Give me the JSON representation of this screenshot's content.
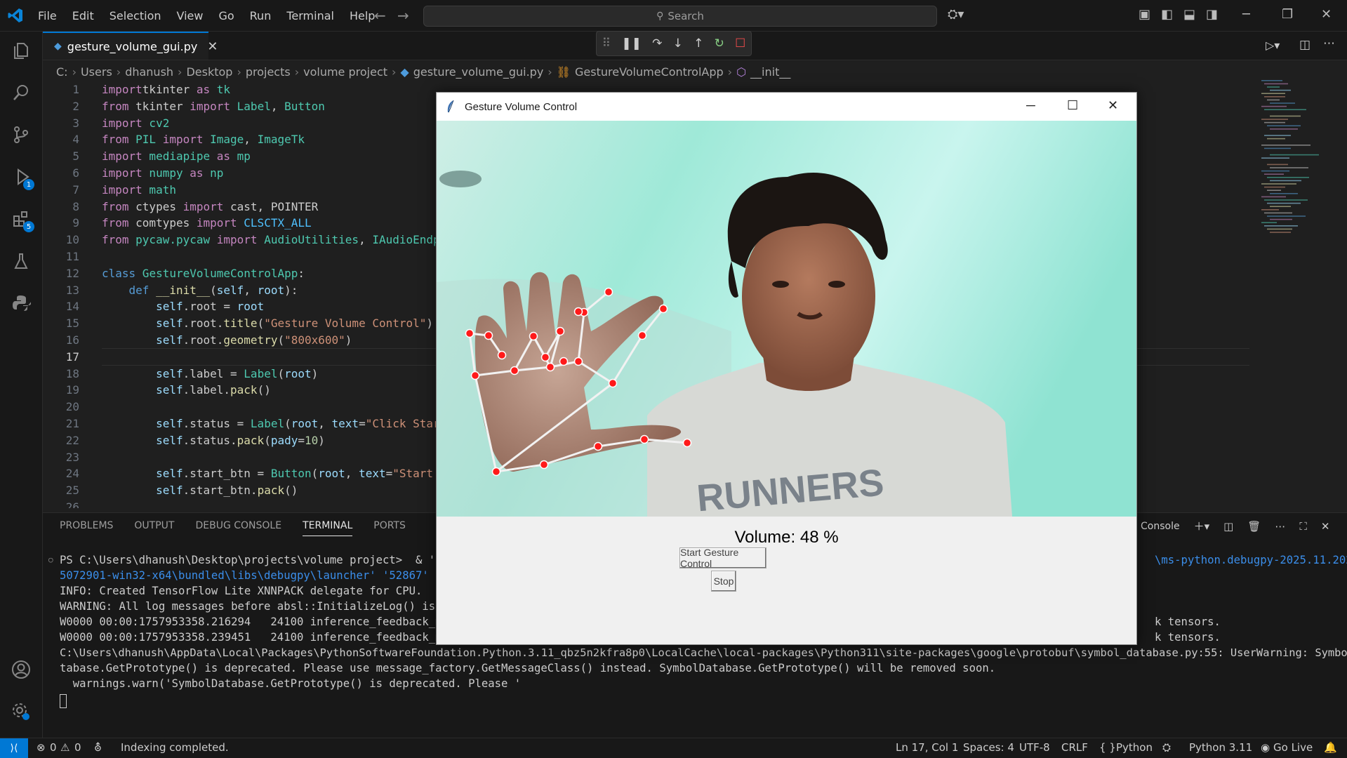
{
  "menu": [
    "File",
    "Edit",
    "Selection",
    "View",
    "Go",
    "Run",
    "Terminal",
    "Help"
  ],
  "search": {
    "label": "Search"
  },
  "activity_badges": {
    "run_debug": "1",
    "extensions": "5"
  },
  "editor": {
    "tab": "gesture_volume_gui.py",
    "breadcrumbs": [
      "C:",
      "Users",
      "dhanush",
      "Desktop",
      "projects",
      "volume project",
      "gesture_volume_gui.py",
      "GestureVolumeControlApp",
      "__init__"
    ],
    "line_numbers": [
      "1",
      "2",
      "3",
      "4",
      "5",
      "6",
      "7",
      "8",
      "9",
      "10",
      "11",
      "12",
      "13",
      "14",
      "15",
      "16",
      "17",
      "18",
      "19",
      "20",
      "21",
      "22",
      "23",
      "24",
      "25",
      "26"
    ],
    "code": [
      [
        [
          "kw",
          "import"
        ],
        [
          "",
          "tkinter "
        ],
        [
          "kw",
          "as"
        ],
        [
          "cls",
          " tk"
        ]
      ],
      [
        [
          "kw",
          "from"
        ],
        [
          "",
          " tkinter "
        ],
        [
          "kw",
          "import"
        ],
        [
          "cls",
          " Label"
        ],
        [
          "",
          ", "
        ],
        [
          "cls",
          "Button"
        ]
      ],
      [
        [
          "kw",
          "import"
        ],
        [
          "cls",
          " cv2"
        ]
      ],
      [
        [
          "kw",
          "from"
        ],
        [
          "cls",
          " PIL "
        ],
        [
          "kw",
          "import"
        ],
        [
          "cls",
          " Image"
        ],
        [
          "",
          ", "
        ],
        [
          "cls",
          "ImageTk"
        ]
      ],
      [
        [
          "kw",
          "import"
        ],
        [
          "cls",
          " mediapipe "
        ],
        [
          "kw",
          "as"
        ],
        [
          "cls",
          " mp"
        ]
      ],
      [
        [
          "kw",
          "import"
        ],
        [
          "cls",
          " numpy "
        ],
        [
          "kw",
          "as"
        ],
        [
          "cls",
          " np"
        ]
      ],
      [
        [
          "kw",
          "import"
        ],
        [
          "cls",
          " math"
        ]
      ],
      [
        [
          "kw",
          "from"
        ],
        [
          "",
          " ctypes "
        ],
        [
          "kw",
          "import"
        ],
        [
          "",
          " cast, POINTER"
        ]
      ],
      [
        [
          "kw",
          "from"
        ],
        [
          "",
          " comtypes "
        ],
        [
          "kw",
          "import"
        ],
        [
          "const",
          " CLSCTX_ALL"
        ]
      ],
      [
        [
          "kw",
          "from"
        ],
        [
          "cls",
          " pycaw.pycaw "
        ],
        [
          "kw",
          "import"
        ],
        [
          "cls",
          " AudioUtilities"
        ],
        [
          "",
          ", "
        ],
        [
          "cls",
          "IAudioEndp"
        ]
      ],
      [],
      [
        [
          "kw2",
          "class"
        ],
        [
          "cls",
          " GestureVolumeControlApp"
        ],
        [
          "",
          ":"
        ]
      ],
      [
        [
          "",
          "    "
        ],
        [
          "kw2",
          "def"
        ],
        [
          "fn",
          " __init__"
        ],
        [
          "",
          "("
        ],
        [
          "var",
          "self"
        ],
        [
          "",
          ", "
        ],
        [
          "var",
          "root"
        ],
        [
          "",
          "):"
        ]
      ],
      [
        [
          "",
          "        "
        ],
        [
          "var",
          "self"
        ],
        [
          "",
          ".root = "
        ],
        [
          "var",
          "root"
        ]
      ],
      [
        [
          "",
          "        "
        ],
        [
          "var",
          "self"
        ],
        [
          "",
          ".root."
        ],
        [
          "fn",
          "title"
        ],
        [
          "",
          "("
        ],
        [
          "str",
          "\"Gesture Volume Control\""
        ],
        [
          "",
          ")"
        ]
      ],
      [
        [
          "",
          "        "
        ],
        [
          "var",
          "self"
        ],
        [
          "",
          ".root."
        ],
        [
          "fn",
          "geometry"
        ],
        [
          "",
          "("
        ],
        [
          "str",
          "\"800x600\""
        ],
        [
          "",
          ")"
        ]
      ],
      [],
      [
        [
          "",
          "        "
        ],
        [
          "var",
          "self"
        ],
        [
          "",
          ".label = "
        ],
        [
          "cls",
          "Label"
        ],
        [
          "",
          "("
        ],
        [
          "var",
          "root"
        ],
        [
          "",
          ")"
        ]
      ],
      [
        [
          "",
          "        "
        ],
        [
          "var",
          "self"
        ],
        [
          "",
          ".label."
        ],
        [
          "fn",
          "pack"
        ],
        [
          "",
          "()"
        ]
      ],
      [],
      [
        [
          "",
          "        "
        ],
        [
          "var",
          "self"
        ],
        [
          "",
          ".status = "
        ],
        [
          "cls",
          "Label"
        ],
        [
          "",
          "("
        ],
        [
          "var",
          "root"
        ],
        [
          "",
          ", "
        ],
        [
          "var",
          "text"
        ],
        [
          "",
          "="
        ],
        [
          "str",
          "\"Click Star"
        ]
      ],
      [
        [
          "",
          "        "
        ],
        [
          "var",
          "self"
        ],
        [
          "",
          ".status."
        ],
        [
          "fn",
          "pack"
        ],
        [
          "",
          "("
        ],
        [
          "var",
          "pady"
        ],
        [
          "",
          "="
        ],
        [
          "num",
          "10"
        ],
        [
          "",
          ")"
        ]
      ],
      [],
      [
        [
          "",
          "        "
        ],
        [
          "var",
          "self"
        ],
        [
          "",
          ".start_btn = "
        ],
        [
          "cls",
          "Button"
        ],
        [
          "",
          "("
        ],
        [
          "var",
          "root"
        ],
        [
          "",
          ", "
        ],
        [
          "var",
          "text"
        ],
        [
          "",
          "="
        ],
        [
          "str",
          "\"Start"
        ]
      ],
      [
        [
          "",
          "        "
        ],
        [
          "var",
          "self"
        ],
        [
          "",
          ".start_btn."
        ],
        [
          "fn",
          "pack"
        ],
        [
          "",
          "()"
        ]
      ],
      []
    ]
  },
  "panel": {
    "tabs": [
      "PROBLEMS",
      "OUTPUT",
      "DEBUG CONSOLE",
      "TERMINAL",
      "PORTS"
    ],
    "active_tab": "TERMINAL",
    "console_label": "Console",
    "terminal_lines": [
      "PS C:\\Users\\dhanush\\Desktop\\projects\\volume project>  & 'c:\\",
      "5072901-win32-x64\\bundled\\libs\\debugpy\\launcher' '52867' '--",
      "INFO: Created TensorFlow Lite XNNPACK delegate for CPU.",
      "WARNING: All log messages before absl::InitializeLog() is ca",
      "W0000 00:00:1757953358.216294   24100 inference_feedback_ma",
      "W0000 00:00:1757953358.239451   24100 inference_feedback_ma",
      "C:\\Users\\dhanush\\AppData\\Local\\Packages\\PythonSoftwareFoundation.Python.3.11_qbz5n2kfra8p0\\LocalCache\\local-packages\\Python311\\site-packages\\google\\protobuf\\symbol_database.py:55: UserWarning: SymbolDa",
      "tabase.GetPrototype() is deprecated. Please use message_factory.GetMessageClass() instead. SymbolDatabase.GetPrototype() will be removed soon.",
      "  warnings.warn('SymbolDatabase.GetPrototype() is deprecated. Please '"
    ],
    "terminal_right": [
      "\\ms-python.debugpy-2025.11.202",
      "k tensors.",
      "k tensors."
    ]
  },
  "status": {
    "errors": "0",
    "warnings": "0",
    "message": "Indexing completed.",
    "position": "Ln 17, Col 1",
    "spaces": "Spaces: 4",
    "encoding": "UTF-8",
    "eol": "CRLF",
    "language": "Python",
    "interpreter": "Python 3.11",
    "live": "Go Live"
  },
  "app": {
    "title": "Gesture Volume Control",
    "volume_text": "Volume: 48 %",
    "start_button": "Start Gesture Control",
    "stop_button": "Stop",
    "shirt_text": "RUNNERS"
  },
  "colors": {
    "accent": "#0078d4",
    "landmark": "#ff1a1a"
  }
}
